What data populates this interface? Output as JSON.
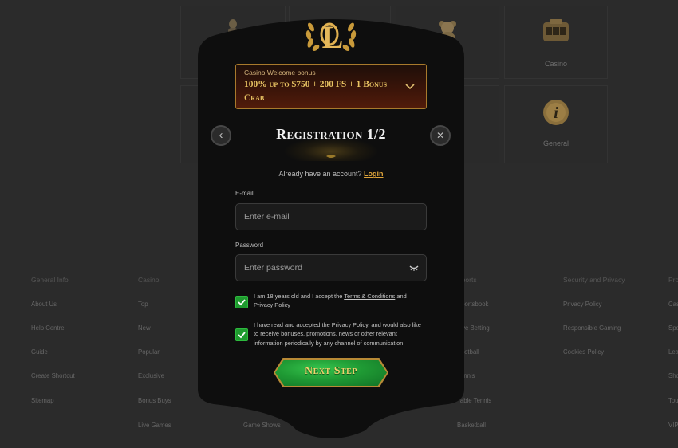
{
  "background": {
    "tiles": [
      {
        "label": "",
        "icon": "figure-icon"
      },
      {
        "label": "",
        "icon": ""
      },
      {
        "label": "",
        "icon": "teddy-bear-icon"
      },
      {
        "label": "Casino",
        "icon": "slot-machine-icon"
      },
      {
        "label": "",
        "icon": ""
      },
      {
        "label": "",
        "icon": ""
      },
      {
        "label": "",
        "icon": ""
      },
      {
        "label": "General",
        "icon": "info-coin-icon"
      }
    ],
    "footer": {
      "columns": [
        {
          "title": "General Info",
          "items": [
            "About Us",
            "Help Centre",
            "Guide",
            "Create Shortcut",
            "Sitemap"
          ]
        },
        {
          "title": "Casino",
          "items": [
            "Top",
            "New",
            "Popular",
            "Exclusive",
            "Bonus Buys",
            "Live Games"
          ]
        },
        {
          "title": "",
          "items": [
            "",
            "",
            "",
            "",
            "",
            "Game Shows"
          ]
        },
        {
          "title": "Sports",
          "items": [
            "Sportsbook",
            "Live Betting",
            "Football",
            "Tennis",
            "Table Tennis",
            "Basketball"
          ]
        },
        {
          "title": "Security and Privacy",
          "items": [
            "Privacy Policy",
            "Responsible Gaming",
            "Cookies Policy"
          ]
        },
        {
          "title": "Promotions",
          "items": [
            "Casino",
            "Sports",
            "Leaderboard",
            "Shop",
            "Tournaments",
            "VIP"
          ]
        }
      ]
    }
  },
  "modal": {
    "logo_icon": "laurel-logo-icon",
    "bonus": {
      "label": "Casino Welcome bonus",
      "value": "100% up to $750 + 200 FS + 1 Bonus Crab",
      "chevron": "⌄"
    },
    "back_icon": "‹",
    "close_icon": "✕",
    "title": "Registration 1/2",
    "have_account_text": "Already have an account?",
    "login_link": "Login",
    "email": {
      "label": "E-mail",
      "placeholder": "Enter e-mail",
      "value": ""
    },
    "password": {
      "label": "Password",
      "placeholder": "Enter password",
      "value": "",
      "toggle_icon": "◡"
    },
    "consent_terms": {
      "checked": true,
      "pre": "I am 18 years old and I accept the ",
      "link1": "Terms & Conditions",
      "mid": " and ",
      "link2": "Privacy Policy",
      "post": ""
    },
    "consent_marketing": {
      "checked": true,
      "pre": "I have read and accepted the ",
      "link1": "Privacy Policy",
      "post": ", and would also like to receive bonuses, promotions, news or other relevant information periodically by any channel of communication."
    },
    "checkmark": "✓",
    "next_label": "Next Step"
  },
  "colors": {
    "accent_gold": "#e0a53a",
    "checkbox_green": "#1f9a2f",
    "button_green": "#1f9a34",
    "modal_bg": "#0e0e0e",
    "page_bg": "#2b2b2b"
  }
}
